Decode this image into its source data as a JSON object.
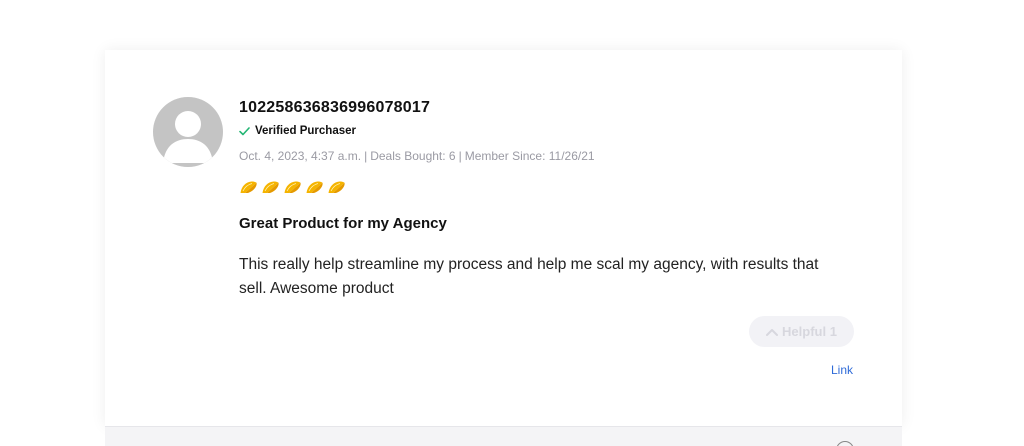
{
  "review": {
    "username": "102258636836996078017",
    "verified_label": "Verified Purchaser",
    "date": "Oct. 4, 2023, 4:37 a.m.",
    "deals_bought": "Deals Bought: 6",
    "member_since": "Member Since: 11/26/21",
    "rating": 5,
    "rating_icon": "taco-icon",
    "title": "Great Product for my Agency",
    "body": "This really help streamline my process and help me scal my agency, with results that sell. Awesome product",
    "helpful_label": "Helpful 1",
    "link_label": "Link"
  },
  "colors": {
    "verified_check": "#22b573",
    "meta_text": "#9a9aa3",
    "link": "#2f6bd8",
    "rating_fill": "#f5b400",
    "helpful_bg": "#f2f2f6",
    "helpful_text": "#d7d7de",
    "avatar": "#c4c4c4"
  }
}
